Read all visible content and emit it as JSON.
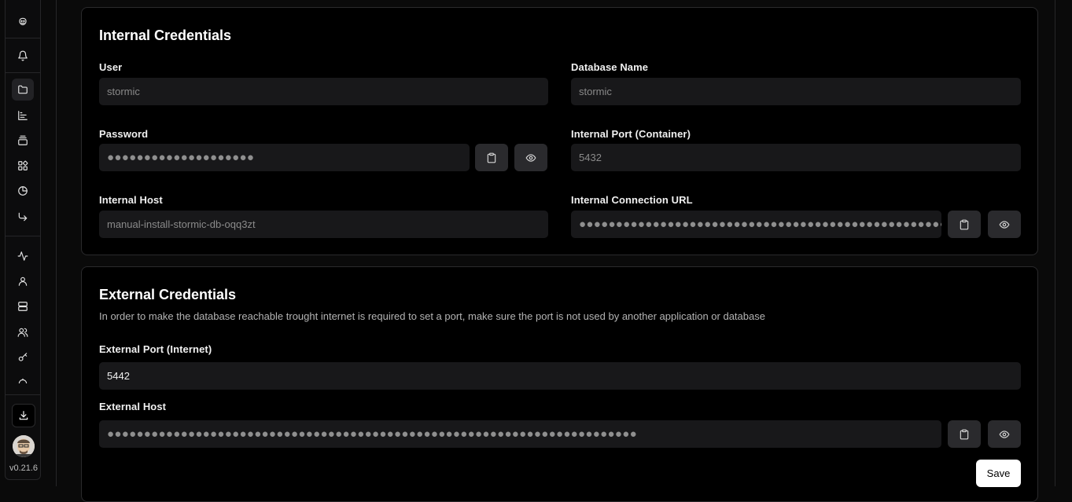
{
  "sidebar": {
    "icons": [
      {
        "name": "logo-icon"
      },
      {
        "name": "bell-icon"
      },
      {
        "name": "folder-icon"
      },
      {
        "name": "chart-icon"
      },
      {
        "name": "layers-icon"
      },
      {
        "name": "apps-icon"
      },
      {
        "name": "pie-chart-icon"
      },
      {
        "name": "forward-icon"
      },
      {
        "name": "activity-icon"
      },
      {
        "name": "user-icon"
      },
      {
        "name": "server-icon"
      },
      {
        "name": "users-icon"
      },
      {
        "name": "key-icon"
      }
    ],
    "version": "v0.21.6"
  },
  "internal": {
    "title": "Internal Credentials",
    "user_label": "User",
    "user_value": "stormic",
    "dbname_label": "Database Name",
    "dbname_value": "stormic",
    "password_label": "Password",
    "password_value": "●●●●●●●●●●●●●●●●●●●●",
    "port_label": "Internal Port (Container)",
    "port_value": "5432",
    "host_label": "Internal Host",
    "host_value": "manual-install-stormic-db-oqq3zt",
    "url_label": "Internal Connection URL",
    "url_value": "●●●●●●●●●●●●●●●●●●●●●●●●●●●●●●●●●●●●●●●●●●●●●●●●●●●●●●●"
  },
  "external": {
    "title": "External Credentials",
    "description": "In order to make the database reachable trought internet is required to set a port, make sure the port is not used by another application or database",
    "port_label": "External Port (Internet)",
    "port_value": "5442",
    "host_label": "External Host",
    "host_value": "●●●●●●●●●●●●●●●●●●●●●●●●●●●●●●●●●●●●●●●●●●●●●●●●●●●●●●●●●●●●●●●●●●●●●●●●",
    "save_label": "Save"
  }
}
